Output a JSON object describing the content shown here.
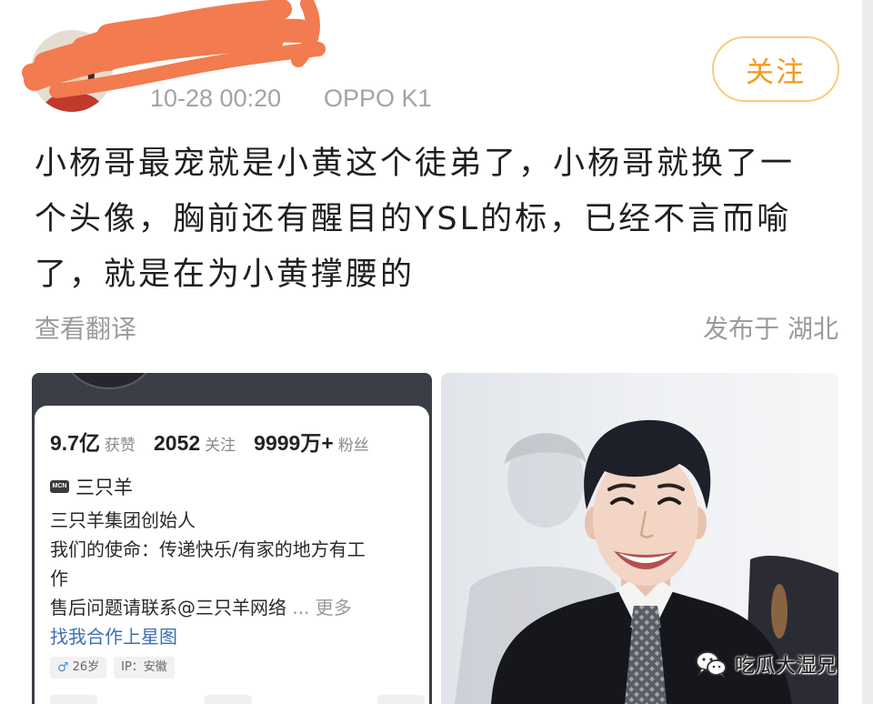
{
  "post": {
    "avatar_icon": "avatar",
    "timestamp": "10-28 00:20",
    "device": "OPPO K1",
    "follow_label": "关注",
    "content_lines": [
      "小杨哥最宠就是小黄这个徒弟了，小杨哥就换了一",
      "个头像，胸前还有醒目的YSL的标，已经不言而喻",
      "了，就是在为小黄撑腰的"
    ],
    "translate_label": "查看翻译",
    "location": "发布于 湖北"
  },
  "profile_screenshot": {
    "stats": [
      {
        "value": "9.7亿",
        "label": "获赞"
      },
      {
        "value": "2052",
        "label": "关注"
      },
      {
        "value": "9999万+",
        "label": "粉丝"
      }
    ],
    "mcn_badge": "MCN",
    "mcn_name": "三只羊",
    "bio_lines": [
      "三只羊集团创始人",
      "我们的使命：传递快乐/有家的地方有工",
      "作"
    ],
    "contact_text": "售后问题请联系@三只羊网络",
    "ellipsis": "...",
    "more_label": "更多",
    "collab_link": "找我合作上星图",
    "tags": [
      {
        "icon": "male-icon",
        "text": "26岁"
      },
      {
        "text": "IP：安徽"
      }
    ]
  },
  "photo": {
    "watermark_icon": "wechat-icon",
    "watermark_text": "吃瓜大湿兄"
  },
  "colors": {
    "follow_accent": "#f29a1c",
    "follow_border": "#f5cd80",
    "redaction": "#f27b4f",
    "link_blue": "#3e6fb4",
    "muted_gray": "#9b9b9b"
  }
}
